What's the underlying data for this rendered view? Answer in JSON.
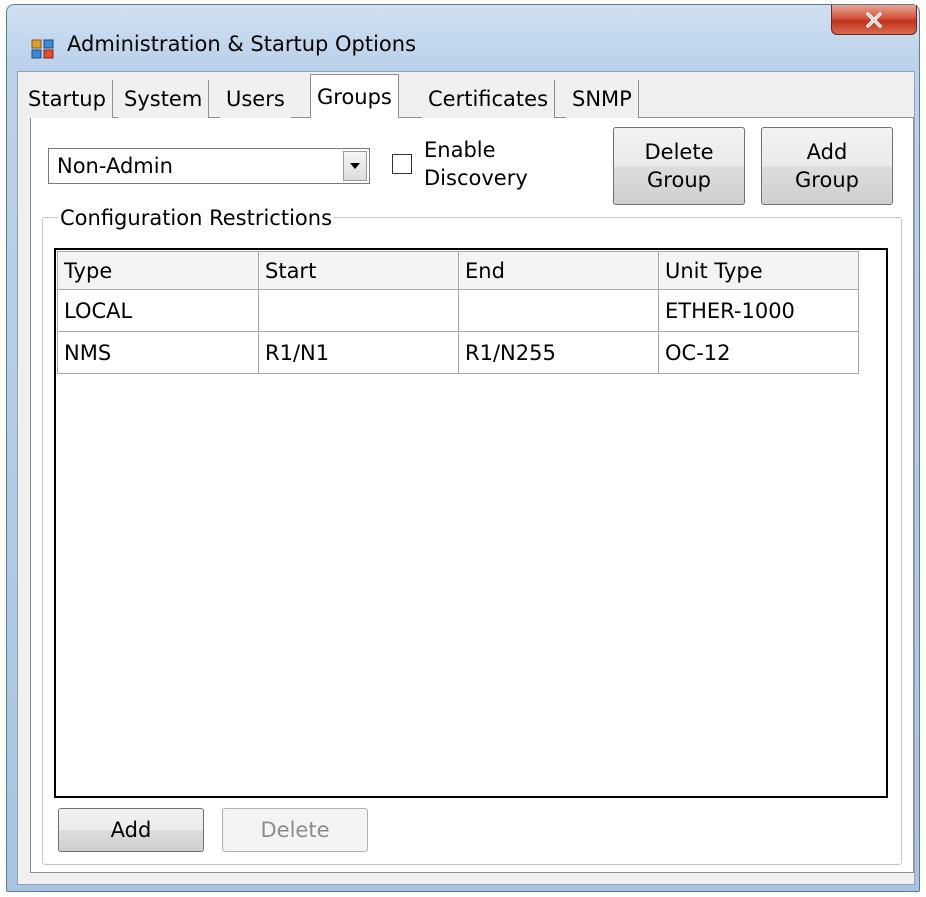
{
  "window": {
    "title": "Administration & Startup Options",
    "close_icon": "close-icon"
  },
  "tabs": [
    {
      "label": "Startup"
    },
    {
      "label": "System"
    },
    {
      "label": "Users"
    },
    {
      "label": "Groups",
      "active": true
    },
    {
      "label": "Certificates"
    },
    {
      "label": "SNMP"
    }
  ],
  "group_select": {
    "value": "Non-Admin"
  },
  "enable_discovery": {
    "line1": "Enable",
    "line2": "Discovery",
    "checked": false
  },
  "buttons": {
    "delete_group_l1": "Delete",
    "delete_group_l2": "Group",
    "add_group_l1": "Add",
    "add_group_l2": "Group",
    "add": "Add",
    "delete": "Delete"
  },
  "restrictions": {
    "legend": "Configuration Restrictions",
    "columns": [
      "Type",
      "Start",
      "End",
      "Unit Type"
    ],
    "rows": [
      [
        "LOCAL",
        "",
        "",
        "ETHER-1000"
      ],
      [
        "NMS",
        "R1/N1",
        "R1/N255",
        "OC-12"
      ]
    ]
  },
  "colors": {
    "title_bar": "#bcd2ea",
    "close_button": "#c2331d",
    "dialog_bg": "#f0f0f0"
  }
}
